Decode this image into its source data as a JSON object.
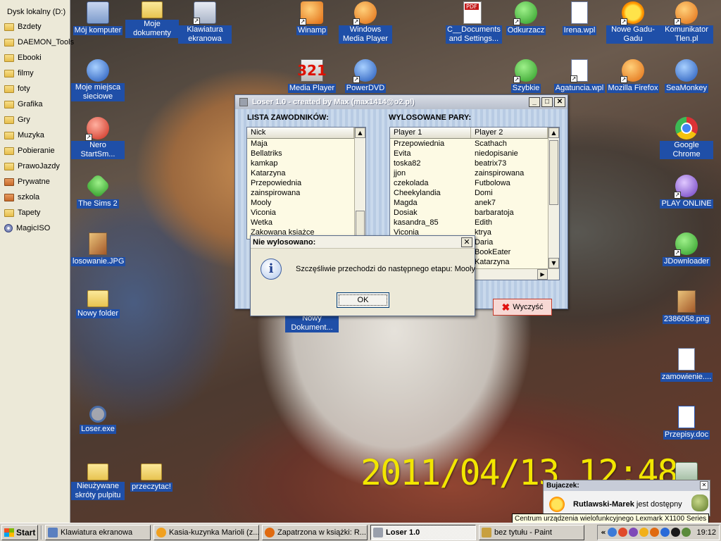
{
  "side_panel": {
    "drive_label": "Dysk lokalny (D:)",
    "items": [
      {
        "label": "Bzdety",
        "icon": "folder-icon"
      },
      {
        "label": "DAEMON_Tools",
        "icon": "folder-icon"
      },
      {
        "label": "Ebooki",
        "icon": "folder-icon"
      },
      {
        "label": "filmy",
        "icon": "folder-icon"
      },
      {
        "label": "foty",
        "icon": "folder-icon"
      },
      {
        "label": "Grafika",
        "icon": "folder-icon"
      },
      {
        "label": "Gry",
        "icon": "folder-icon"
      },
      {
        "label": "Muzyka",
        "icon": "folder-icon"
      },
      {
        "label": "Pobieranie",
        "icon": "folder-icon"
      },
      {
        "label": "PrawoJazdy",
        "icon": "folder-icon"
      },
      {
        "label": "Prywatne",
        "icon": "archive-icon"
      },
      {
        "label": "szkola",
        "icon": "archive-icon"
      },
      {
        "label": "Tapety",
        "icon": "folder-icon"
      },
      {
        "label": "MagicISO",
        "icon": "disc-icon"
      }
    ]
  },
  "desktop_icons": {
    "moj_komputer": "Mój komputer",
    "moje_dokumenty": "Moje dokumenty",
    "klawiatura": "Klawiatura ekranowa",
    "winamp": "Winamp",
    "wmp": "Windows Media Player",
    "c_documents": "C__Documents and Settings...",
    "odkurzacz": "Odkurzacz",
    "irena": "Irena.wpl",
    "gadu": "Nowe Gadu-Gadu",
    "tlen": "Komunikator Tlen.pl",
    "moje_miejsca": "Moje miejsca sieciowe",
    "media_player": "Media Player",
    "powerdvd": "PowerDVD",
    "szybkie": "Szybkie",
    "agatuncia": "Agatuncia.wpl",
    "firefox": "Mozilla Firefox",
    "seamonkey": "SeaMonkey",
    "nero": "Nero StartSm...",
    "google_chrome": "Google Chrome",
    "sims": "The Sims 2",
    "play_online": "PLAY ONLINE",
    "losowanie": "losowanie.JPG",
    "jdownloader": "JDownloader",
    "nowy_folder": "Nowy folder",
    "nowy_dokument": "Nowy Dokument...",
    "png_2386058": "2386058.png",
    "zamowienie": "zamowienie....",
    "loser_exe": "Loser.exe",
    "przepisy": "Przepisy.doc",
    "nieuzywane": "Nieużywane skróty pulpitu",
    "przeczytac": "przeczytac!"
  },
  "datestamp": "2011/04/13 12:48",
  "loser_window": {
    "title": "Loser 1.0 - created by Max (max1414@o2.pl)",
    "contestants_title": "LISTA ZAWODNIKÓW:",
    "pairs_title": "WYLOSOWANE PARY:",
    "nick_header": "Nick",
    "player1_header": "Player 1",
    "player2_header": "Player 2",
    "contestants": [
      "Maja",
      "Bellatriks",
      "kamkap",
      "Katarzyna",
      "Przepowiednia",
      "zainspirowana",
      "Mooly",
      "Viconia",
      "Wetka",
      "Zakowana ksiażce"
    ],
    "pairs": [
      {
        "p1": "Przepowiednia",
        "p2": "Scathach"
      },
      {
        "p1": "Evita",
        "p2": "niedopisanie"
      },
      {
        "p1": "toska82",
        "p2": "beatrix73"
      },
      {
        "p1": "jjon",
        "p2": "zainspirowana"
      },
      {
        "p1": "czekolada",
        "p2": "Futbolowa"
      },
      {
        "p1": "Cheekylandia",
        "p2": "Domi"
      },
      {
        "p1": "Magda",
        "p2": "anek7"
      },
      {
        "p1": "Dosiak",
        "p2": "barbaratoja"
      },
      {
        "p1": "kasandra_85",
        "p2": "Edith"
      },
      {
        "p1": "Viconia",
        "p2": "ktrya"
      },
      {
        "p1": "",
        "p2": "Daria"
      },
      {
        "p1": "",
        "p2": "BookEater"
      },
      {
        "p1": "",
        "p2": "Katarzyna"
      }
    ],
    "clear_label": "Wyczyść"
  },
  "message_box": {
    "title": "Nie wylosowano:",
    "text": "Szczęśliwie przechodzi do następnego etapu: Mooly",
    "ok_label": "OK"
  },
  "notification": {
    "title": "Bujaczek:",
    "user": "Rutlawski-Marek",
    "status": " jest dostępny"
  },
  "tooltip": "Centrum urządzenia wielofunkcyjnego Lexmark X1100 Series",
  "taskbar": {
    "start_label": "Start",
    "tasks": [
      {
        "label": "Klawiatura ekranowa",
        "active": false,
        "color": "#5a7fc0"
      },
      {
        "label": "Kasia-kuzynka Marioli (z...",
        "active": false,
        "color": "#f0a020"
      },
      {
        "label": "Zapatrzona w książki: R...",
        "active": false,
        "color": "#e06a10"
      },
      {
        "label": "Loser 1.0",
        "active": true,
        "color": "#9aa0ac"
      },
      {
        "label": "bez tytułu - Paint",
        "active": false,
        "color": "#c8a040"
      }
    ],
    "clock": "19:12"
  }
}
